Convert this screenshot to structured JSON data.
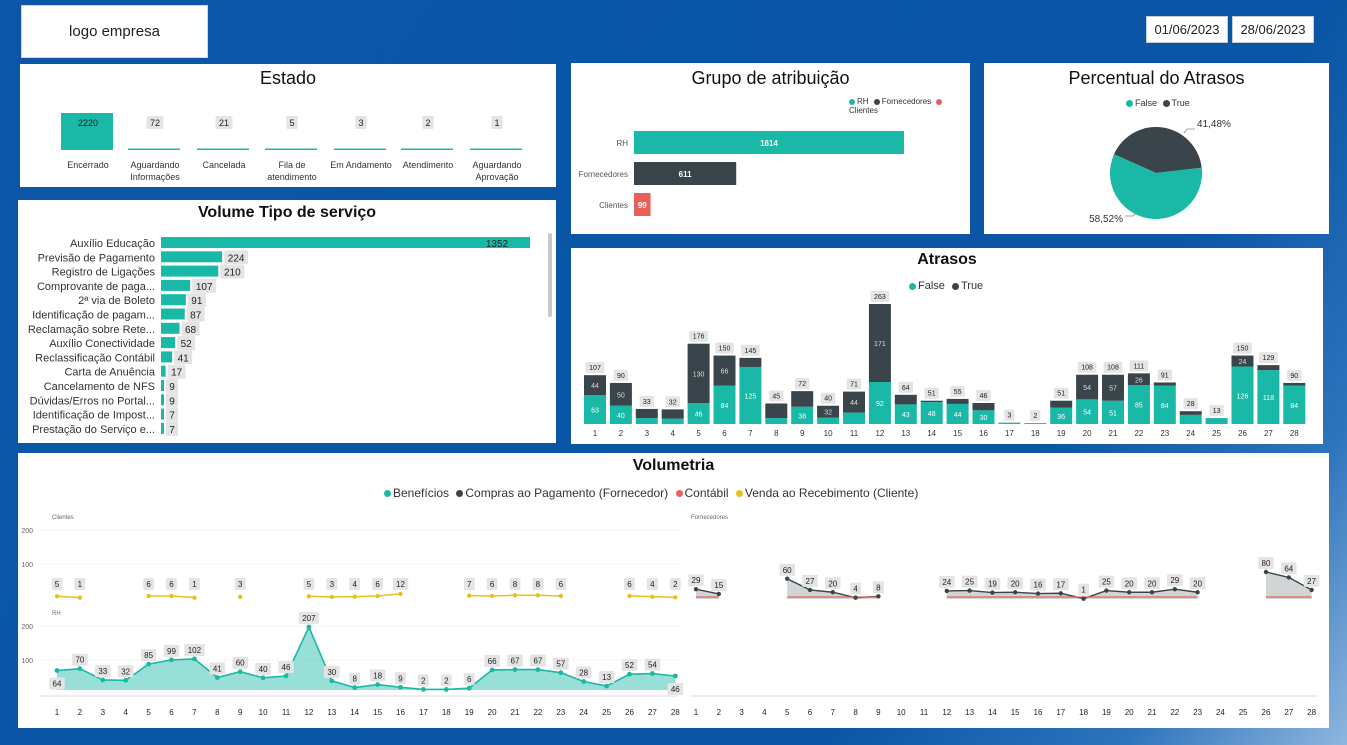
{
  "header": {
    "logo_text": "logo empresa",
    "date_start": "01/06/2023",
    "date_end": "28/06/2023"
  },
  "colors": {
    "teal": "#1ab8a6",
    "dark": "#39454a",
    "red": "#e8605a",
    "yellow": "#e8c01d",
    "label_bg": "#e4e4e4"
  },
  "estado": {
    "title": "Estado",
    "items": [
      {
        "label": "Encerrado",
        "value": 2220
      },
      {
        "label": "Aguardando Informações",
        "value": 72
      },
      {
        "label": "Cancelada",
        "value": 21
      },
      {
        "label": "Fila de atendimento",
        "value": 5
      },
      {
        "label": "Em Andamento",
        "value": 3
      },
      {
        "label": "Atendimento",
        "value": 2
      },
      {
        "label": "Aguardando Aprovação",
        "value": 1
      }
    ]
  },
  "grupo": {
    "title": "Grupo de atribuição",
    "legend": [
      "RH",
      "Fornecedores",
      "Clientes"
    ],
    "chart_data": {
      "type": "bar",
      "categories": [
        "RH",
        "Fornecedores",
        "Clientes"
      ],
      "values": [
        1614,
        611,
        99
      ]
    }
  },
  "percentual": {
    "title": "Percentual do Atrasos",
    "legend": [
      "False",
      "True"
    ],
    "chart_data": {
      "type": "pie",
      "labels": [
        "False",
        "True"
      ],
      "values": [
        58.52,
        41.48
      ],
      "display": [
        "58,52%",
        "41,48%"
      ]
    }
  },
  "volume": {
    "title": "Volume Tipo de serviço",
    "chart_data": {
      "type": "bar",
      "categories": [
        "Auxílio Educação",
        "Previsão de Pagamento",
        "Registro de Ligações",
        "Comprovante de paga...",
        "2ª via de Boleto",
        "Identificação de pagam...",
        "Reclamação sobre Rete...",
        "Auxílio Conectividade",
        "Reclassificação Contábil",
        "Carta de Anuência",
        "Cancelamento de NFS",
        "Dúvidas/Erros no Portal...",
        "Identificação de Impost...",
        "Prestação do Serviço e..."
      ],
      "values": [
        1352,
        224,
        210,
        107,
        91,
        87,
        68,
        52,
        41,
        17,
        9,
        9,
        7,
        7
      ]
    }
  },
  "atrasos": {
    "title": "Atrasos",
    "legend": [
      "False",
      "True"
    ],
    "chart_data": {
      "type": "bar",
      "stacked": true,
      "categories": [
        "1",
        "2",
        "3",
        "4",
        "5",
        "6",
        "7",
        "8",
        "9",
        "10",
        "11",
        "12",
        "13",
        "14",
        "15",
        "16",
        "17",
        "18",
        "19",
        "20",
        "21",
        "22",
        "23",
        "24",
        "25",
        "26",
        "27",
        "28"
      ],
      "totals": [
        107,
        90,
        33,
        32,
        176,
        150,
        145,
        45,
        72,
        40,
        71,
        263,
        64,
        51,
        55,
        46,
        3,
        2,
        51,
        108,
        108,
        111,
        91,
        28,
        13,
        150,
        129,
        90
      ],
      "series": [
        {
          "name": "False",
          "values": [
            63,
            40,
            13,
            12,
            46,
            84,
            125,
            13,
            38,
            14,
            25,
            92,
            43,
            48,
            44,
            30,
            3,
            2,
            36,
            54,
            51,
            85,
            84,
            20,
            13,
            126,
            118,
            84
          ]
        },
        {
          "name": "True",
          "values": [
            44,
            50,
            20,
            20,
            130,
            66,
            20,
            32,
            34,
            26,
            46,
            171,
            21,
            3,
            11,
            16,
            0,
            0,
            15,
            54,
            57,
            26,
            7,
            8,
            0,
            24,
            11,
            6
          ]
        }
      ],
      "labels_false": [
        "63",
        "40",
        "",
        "",
        "46",
        "84",
        "125",
        "",
        "38",
        "",
        "",
        "92",
        "43",
        "48",
        "44",
        "30",
        "",
        "",
        "36",
        "54",
        "51",
        "85",
        "84",
        "",
        "",
        "126",
        "118",
        "84"
      ],
      "labels_true": [
        "44",
        "50",
        "",
        "",
        "130",
        "66",
        "",
        "",
        "",
        "32",
        "44",
        "171",
        "",
        "",
        "",
        "",
        "",
        "",
        "",
        "54",
        "57",
        "26",
        "",
        "",
        "",
        "24",
        "",
        ""
      ]
    }
  },
  "volumetria": {
    "title": "Volumetria",
    "legend": [
      "Benefícios",
      "Compras ao Pagamento (Fornecedor)",
      "Contábil",
      "Venda ao Recebimento (Cliente)"
    ],
    "panel_clientes": "Clientes",
    "panel_rh": "RH",
    "panel_fornecedores": "Fornecedores",
    "yticks": [
      "200",
      "100"
    ],
    "chart_data": {
      "type": "line",
      "x": [
        "1",
        "2",
        "3",
        "4",
        "5",
        "6",
        "7",
        "8",
        "9",
        "10",
        "11",
        "12",
        "13",
        "14",
        "15",
        "16",
        "17",
        "18",
        "19",
        "20",
        "21",
        "22",
        "23",
        "24",
        "25",
        "26",
        "27",
        "28"
      ],
      "clientes": [
        5,
        1,
        null,
        null,
        6,
        6,
        1,
        null,
        3,
        null,
        null,
        5,
        3,
        4,
        6,
        12,
        null,
        null,
        7,
        6,
        8,
        8,
        6,
        null,
        null,
        6,
        4,
        2
      ],
      "rh": [
        64,
        70,
        33,
        32,
        85,
        99,
        102,
        41,
        60,
        40,
        46,
        207,
        30,
        8,
        18,
        9,
        2,
        2,
        6,
        66,
        67,
        67,
        57,
        28,
        13,
        52,
        54,
        46
      ],
      "fornecedores": [
        29,
        15,
        null,
        null,
        60,
        27,
        20,
        4,
        8,
        null,
        null,
        24,
        25,
        19,
        20,
        16,
        17,
        1,
        25,
        20,
        20,
        29,
        20,
        null,
        null,
        80,
        64,
        27
      ]
    }
  }
}
